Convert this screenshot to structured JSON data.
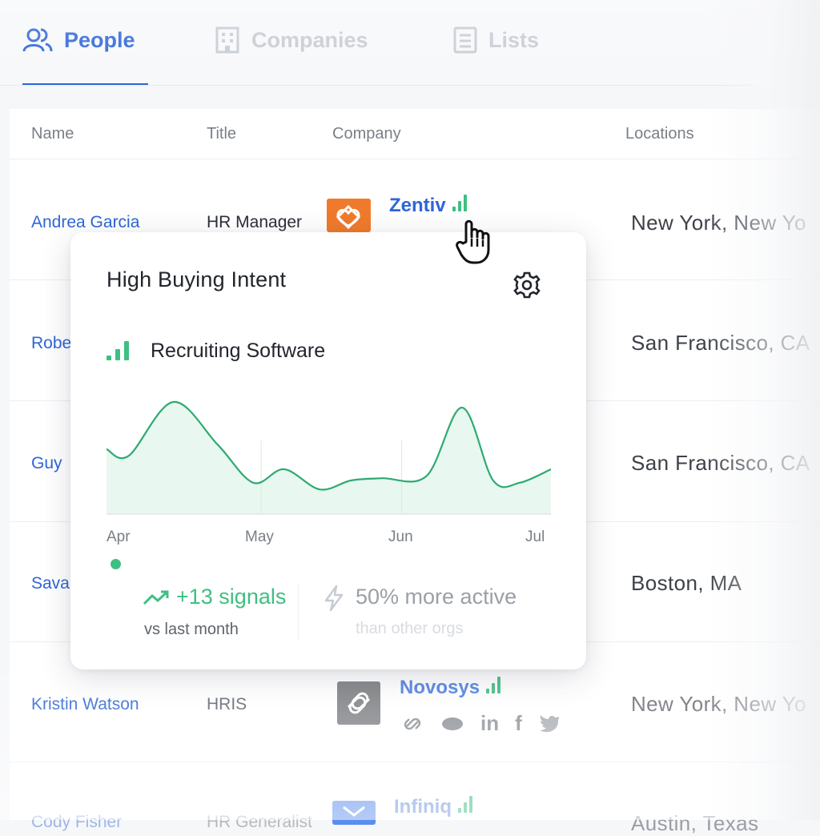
{
  "tabs": [
    {
      "label": "People",
      "icon": "people-icon",
      "active": true
    },
    {
      "label": "Companies",
      "icon": "building-icon",
      "active": false
    },
    {
      "label": "Lists",
      "icon": "list-icon",
      "active": false
    }
  ],
  "table": {
    "headers": {
      "name": "Name",
      "title": "Title",
      "company": "Company",
      "locations": "Locations"
    },
    "rows": [
      {
        "name": "Andrea Garcia",
        "title": "HR Manager",
        "company": "Zentiv",
        "location": "New York, New Yo"
      },
      {
        "name": "Robe",
        "title": "",
        "company": "",
        "location": "San Francisco, CA"
      },
      {
        "name": "Guy",
        "title": "",
        "company": "",
        "location": "San Francisco, CA"
      },
      {
        "name": "Sava",
        "title": "",
        "company": "",
        "location": "Boston, MA"
      },
      {
        "name": "Kristin Watson",
        "title": "HRIS",
        "company": "Novosys",
        "location": "New York, New Yo"
      },
      {
        "name": "Cody Fisher",
        "title": "HR Generalist",
        "company": "Infiniq",
        "location": "Austin, Texas"
      }
    ]
  },
  "popover": {
    "title": "High Buying Intent",
    "topic": "Recruiting Software",
    "months": [
      "Apr",
      "May",
      "Jun",
      "Jul"
    ],
    "signals": "+13 signals",
    "signals_sub": "vs last month",
    "activity": "50% more active",
    "activity_sub": "than other orgs"
  },
  "colors": {
    "accent": "#2f66d6",
    "positive": "#3fbf82",
    "zentiv_logo": "#f07a2c",
    "novosys_logo": "#7d7f83",
    "infiniq_logo": "#5b8def"
  },
  "chart_data": {
    "type": "area",
    "title": "",
    "xlabel": "",
    "ylabel": "",
    "x_ticks": [
      "Apr",
      "May",
      "Jun",
      "Jul"
    ],
    "grid": false,
    "legend": "none",
    "series": [
      {
        "x": [
          0,
          0.05,
          0.15,
          0.25,
          0.33,
          0.4,
          0.48,
          0.55,
          0.62,
          0.72,
          0.8,
          0.87,
          0.93,
          1.0
        ],
        "values": [
          0.58,
          0.52,
          1.0,
          0.62,
          0.28,
          0.4,
          0.22,
          0.3,
          0.32,
          0.34,
          0.95,
          0.3,
          0.28,
          0.4
        ]
      }
    ]
  }
}
